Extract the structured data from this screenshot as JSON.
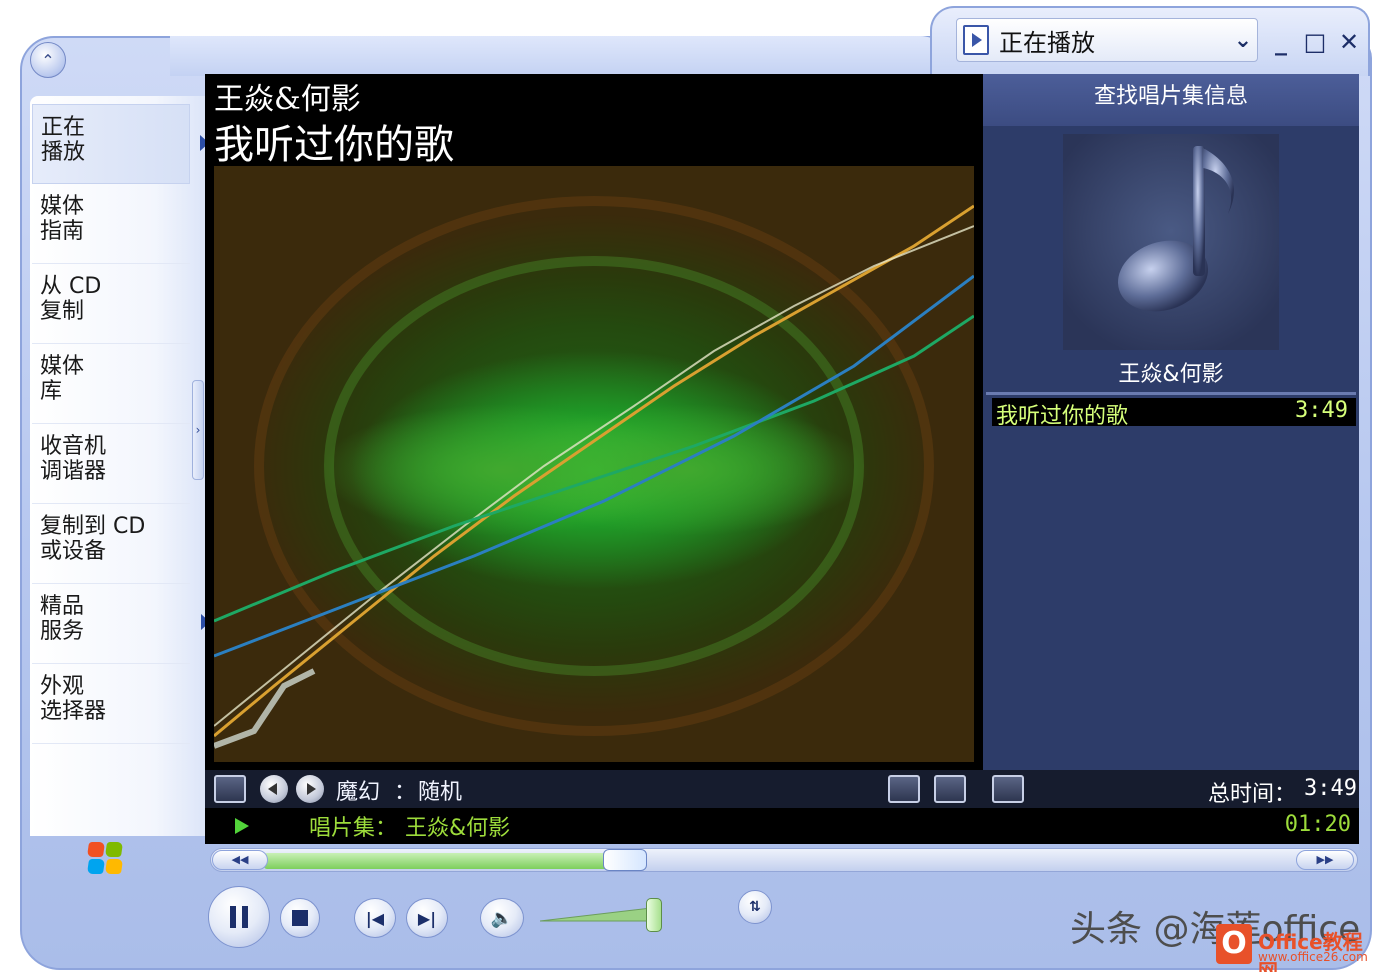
{
  "window": {
    "playlist_selected": "正在播放",
    "minimize_icon": "minimize-icon",
    "maximize_icon": "maximize-icon",
    "close_icon": "close-icon"
  },
  "nav": {
    "items": [
      {
        "label": "正在\n播放",
        "active": true,
        "has_arrow": true
      },
      {
        "label": "媒体\n指南",
        "active": false,
        "has_arrow": false
      },
      {
        "label": "从 CD\n复制",
        "active": false,
        "has_arrow": false
      },
      {
        "label": "媒体\n库",
        "active": false,
        "has_arrow": false
      },
      {
        "label": "收音机\n调谐器",
        "active": false,
        "has_arrow": false
      },
      {
        "label": "复制到 CD\n或设备",
        "active": false,
        "has_arrow": false
      },
      {
        "label": "精品\n服务",
        "active": false,
        "has_arrow": true
      },
      {
        "label": "外观\n选择器",
        "active": false,
        "has_arrow": false
      }
    ]
  },
  "video": {
    "artist": "王焱&何影",
    "title": "我听过你的歌",
    "visualization_name": "魔幻",
    "visualization_separator": "：",
    "visualization_preset": "随机"
  },
  "playlist": {
    "header": "查找唱片集信息",
    "album_artist": "王焱&何影",
    "items": [
      {
        "title": "我听过你的歌",
        "duration": "3:49"
      }
    ],
    "total_label": "总时间：",
    "total_value": "3:49"
  },
  "status": {
    "album_label": "唱片集：",
    "album_value": "王焱&何影",
    "current_time": "01:20"
  },
  "seek": {
    "progress": 0.35
  },
  "volume": {
    "level": 0.95
  },
  "overlay": {
    "watermark": "头条 @海莲office",
    "brand_text": "Office教程网",
    "brand_url": "www.office26.com"
  },
  "colors": {
    "status_text": "#9ddc3b",
    "playlist_text": "#d6ff7a",
    "accent": "#2d4793"
  }
}
